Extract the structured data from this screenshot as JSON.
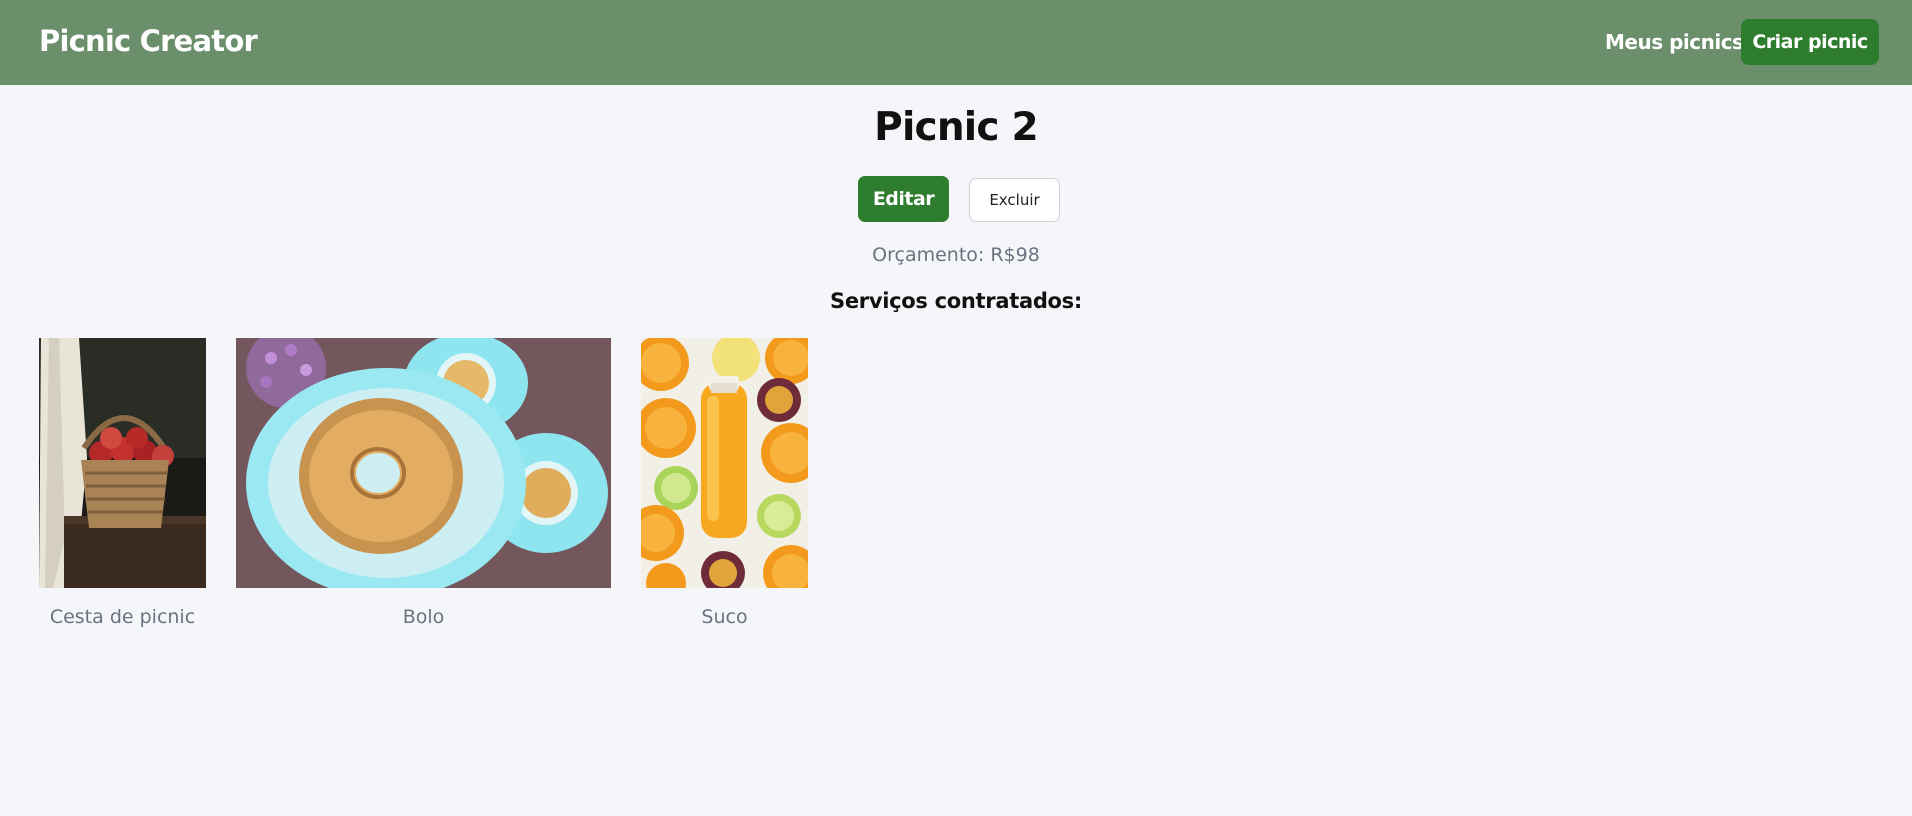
{
  "header": {
    "brand": "Picnic Creator",
    "nav_link": "Meus picnics",
    "create_button": "Criar picnic"
  },
  "picnic": {
    "title": "Picnic 2",
    "edit_button": "Editar",
    "delete_button": "Excluir",
    "budget": "Orçamento: R$98",
    "services_heading": "Serviços contratados:"
  },
  "services": [
    {
      "name": "Cesta de picnic"
    },
    {
      "name": "Bolo"
    },
    {
      "name": "Suco"
    }
  ],
  "colors": {
    "header_bg": "#6b8e6b",
    "primary": "#2e7d2e",
    "page_bg": "#f5f6f9",
    "muted_text": "#6b7280"
  }
}
